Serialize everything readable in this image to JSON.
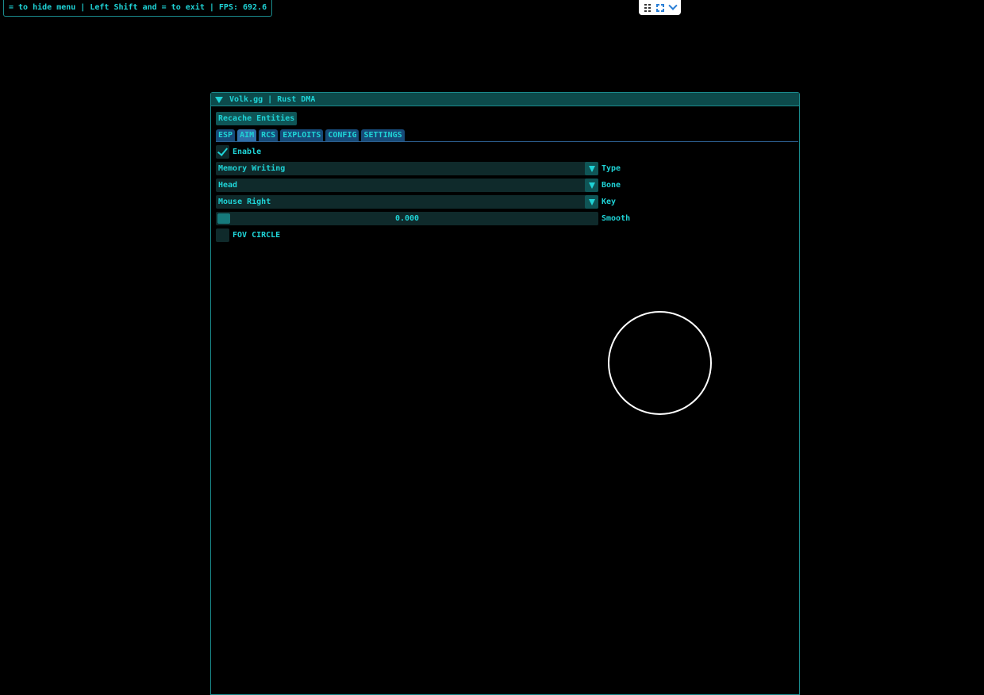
{
  "status_bar": {
    "text": "= to hide menu | Left Shift and = to exit | FPS: 692.6"
  },
  "overlay_toolbar": {
    "icons": [
      "drag-grip-icon",
      "fullscreen-icon",
      "chevron-down-icon"
    ]
  },
  "window": {
    "title": "Volk.gg | Rust DMA",
    "recache_label": "Recache Entities",
    "tabs": [
      {
        "label": "ESP",
        "active": false
      },
      {
        "label": "AIM",
        "active": true
      },
      {
        "label": "RCS",
        "active": false
      },
      {
        "label": "EXPLOITS",
        "active": false
      },
      {
        "label": "CONFIG",
        "active": false
      },
      {
        "label": "SETTINGS",
        "active": false
      }
    ],
    "aim": {
      "enable": {
        "label": "Enable",
        "checked": true
      },
      "type": {
        "value": "Memory Writing",
        "label": "Type"
      },
      "bone": {
        "value": "Head",
        "label": "Bone"
      },
      "key": {
        "value": "Mouse Right",
        "label": "Key"
      },
      "smooth": {
        "value": "0.000",
        "label": "Smooth"
      },
      "fov_circle": {
        "label": "FOV CIRCLE",
        "checked": false
      }
    }
  },
  "colors": {
    "text": "#1fd3d6",
    "border": "#1a8a8c",
    "frame_bg": "#0f2a2b",
    "button_bg": "#0f5556",
    "tab_bg": "#174a78",
    "tab_active_bg": "#2f6fa8",
    "circle": "#ffffff"
  }
}
